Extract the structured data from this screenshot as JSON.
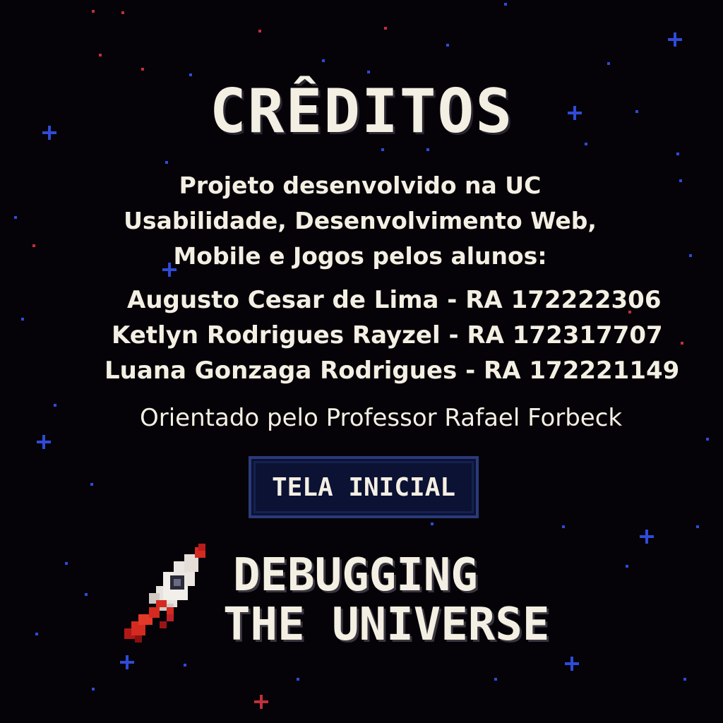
{
  "screen": {
    "title": "CRÊDITOS",
    "intro_lines": [
      "Projeto desenvolvido na UC",
      "Usabilidade, Desenvolvimento Web,",
      "Mobile e Jogos pelos alunos:"
    ],
    "students": [
      "Augusto Cesar de Lima - RA 172222306",
      "Ketlyn Rodrigues Rayzel - RA 172317707",
      "Luana Gonzaga Rodrigues - RA 172221149"
    ],
    "advisor": "Orientado pelo Professor Rafael Forbeck",
    "home_button_label": "TELA INICIAL",
    "logo": {
      "line1": "DEBUGGING",
      "line2": "THE UNIVERSE",
      "icon": "rocket-icon"
    }
  },
  "colors": {
    "background": "#050308",
    "text": "#f4efe3",
    "button_bg": "#0b1233",
    "button_border": "#2a3a7a",
    "star_blue": "#2f4bd8",
    "star_red": "#c0303a",
    "rocket_red": "#d42a20"
  }
}
